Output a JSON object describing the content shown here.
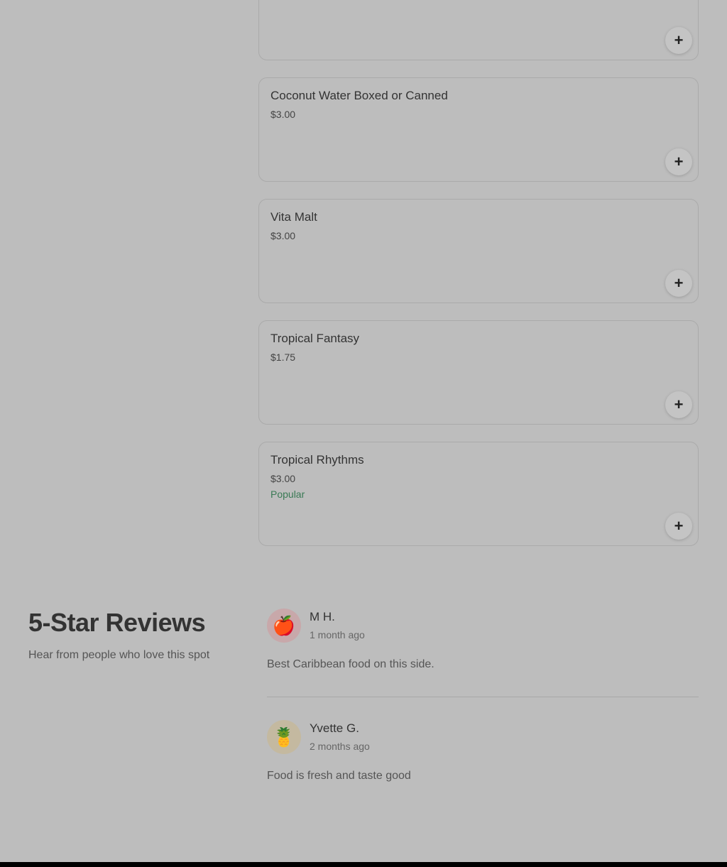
{
  "menu": {
    "items": [
      {
        "name": "",
        "price": "",
        "badge": "",
        "add_label": "+"
      },
      {
        "name": "Coconut Water Boxed or Canned",
        "price": "$3.00",
        "badge": "",
        "add_label": "+"
      },
      {
        "name": "Vita Malt",
        "price": "$3.00",
        "badge": "",
        "add_label": "+"
      },
      {
        "name": "Tropical Fantasy",
        "price": "$1.75",
        "badge": "",
        "add_label": "+"
      },
      {
        "name": "Tropical Rhythms",
        "price": "$3.00",
        "badge": "Popular",
        "add_label": "+"
      }
    ]
  },
  "reviews": {
    "title": "5-Star Reviews",
    "subtitle": "Hear from people who love this spot",
    "list": [
      {
        "avatar_icon": "apple-icon",
        "avatar_glyph": "🍎",
        "name": "M H.",
        "date": "1 month ago",
        "text": "Best Caribbean food on this side."
      },
      {
        "avatar_icon": "pineapple-icon",
        "avatar_glyph": "🍍",
        "name": "Yvette G.",
        "date": "2 months ago",
        "text": "Food is fresh and taste good"
      }
    ]
  },
  "colors": {
    "background": "#bdbdbd",
    "popular_badge": "#3a7a55",
    "footer": "#000000"
  }
}
